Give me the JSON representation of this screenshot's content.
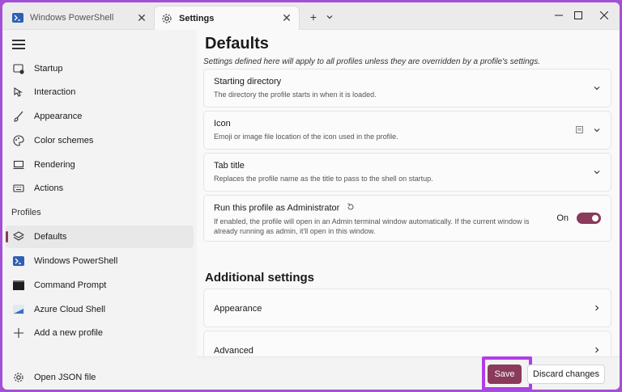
{
  "tabs": [
    {
      "label": "Windows PowerShell",
      "icon": "powershell-icon",
      "active": false
    },
    {
      "label": "Settings",
      "icon": "gear-icon",
      "active": true
    }
  ],
  "sidebar": {
    "items": [
      {
        "label": "Startup",
        "icon": "startup-icon"
      },
      {
        "label": "Interaction",
        "icon": "interaction-icon"
      },
      {
        "label": "Appearance",
        "icon": "paintbrush-icon"
      },
      {
        "label": "Color schemes",
        "icon": "palette-icon"
      },
      {
        "label": "Rendering",
        "icon": "monitor-icon"
      },
      {
        "label": "Actions",
        "icon": "keyboard-icon"
      }
    ],
    "profiles_header": "Profiles",
    "profiles": [
      {
        "label": "Defaults",
        "icon": "layers-icon",
        "selected": true
      },
      {
        "label": "Windows PowerShell",
        "icon": "powershell-icon"
      },
      {
        "label": "Command Prompt",
        "icon": "cmd-icon"
      },
      {
        "label": "Azure Cloud Shell",
        "icon": "azure-icon"
      },
      {
        "label": "Add a new profile",
        "icon": "plus-icon"
      }
    ],
    "open_json": "Open JSON file"
  },
  "main": {
    "title": "Defaults",
    "subtitle": "Settings defined here will apply to all profiles unless they are overridden by a profile's settings.",
    "cards": [
      {
        "title": "Starting directory",
        "desc": "The directory the profile starts in when it is loaded."
      },
      {
        "title": "Icon",
        "desc": "Emoji or image file location of the icon used in the profile."
      },
      {
        "title": "Tab title",
        "desc": "Replaces the profile name as the title to pass to the shell on startup."
      },
      {
        "title": "Run this profile as Administrator",
        "desc": "If enabled, the profile will open in an Admin terminal window automatically. If the current window is already running as admin, it'll open in this window.",
        "toggle_label": "On"
      }
    ],
    "additional_title": "Additional settings",
    "additional": [
      {
        "title": "Appearance"
      },
      {
        "title": "Advanced"
      }
    ]
  },
  "footer": {
    "save_label": "Save",
    "discard_label": "Discard changes"
  },
  "colors": {
    "accent": "#8a3a5a",
    "highlight": "#b23de8",
    "frame": "#a34fd6"
  }
}
